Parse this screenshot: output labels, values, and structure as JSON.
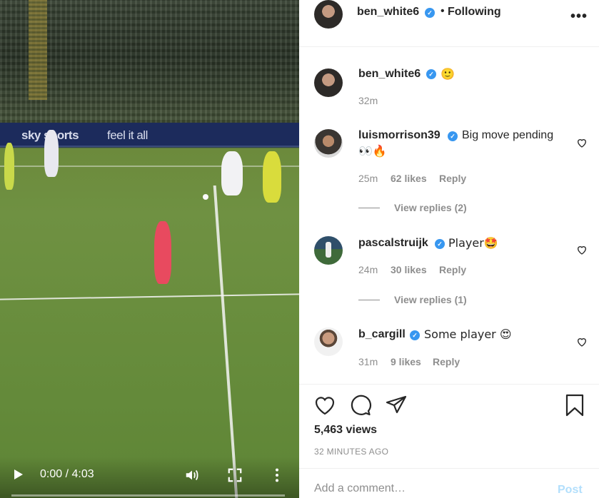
{
  "video": {
    "board_text_1": "sky sports",
    "board_text_2": "feel it all",
    "time_current": "0:00",
    "time_separator": "/",
    "time_total": "4:03",
    "progress": 0
  },
  "header": {
    "username": "ben_white6",
    "separator": "•",
    "follow_status": "Following",
    "more_icon": "more-dots-icon"
  },
  "caption": {
    "username": "ben_white6",
    "text": "🙂",
    "time": "32m"
  },
  "comments": [
    {
      "username": "luismorrison39",
      "text": "Big move pending",
      "text_line2": "👀🔥",
      "time": "25m",
      "likes": "62 likes",
      "reply": "Reply",
      "view_replies": "View replies (2)"
    },
    {
      "username": "pascalstruijk",
      "text": "Player🤩",
      "time": "24m",
      "likes": "30 likes",
      "reply": "Reply",
      "view_replies": "View replies (1)"
    },
    {
      "username": "b_cargill",
      "text": "Some player 😍",
      "time": "31m",
      "likes": "9 likes",
      "reply": "Reply"
    }
  ],
  "actions": {
    "views": "5,463 views",
    "timestamp": "32 MINUTES AGO"
  },
  "add_comment": {
    "placeholder": "Add a comment…",
    "post_label": "Post"
  },
  "colors": {
    "verified": "#3897f0",
    "post_disabled": "#b2dffc",
    "meta_gray": "#8e8e8e"
  }
}
